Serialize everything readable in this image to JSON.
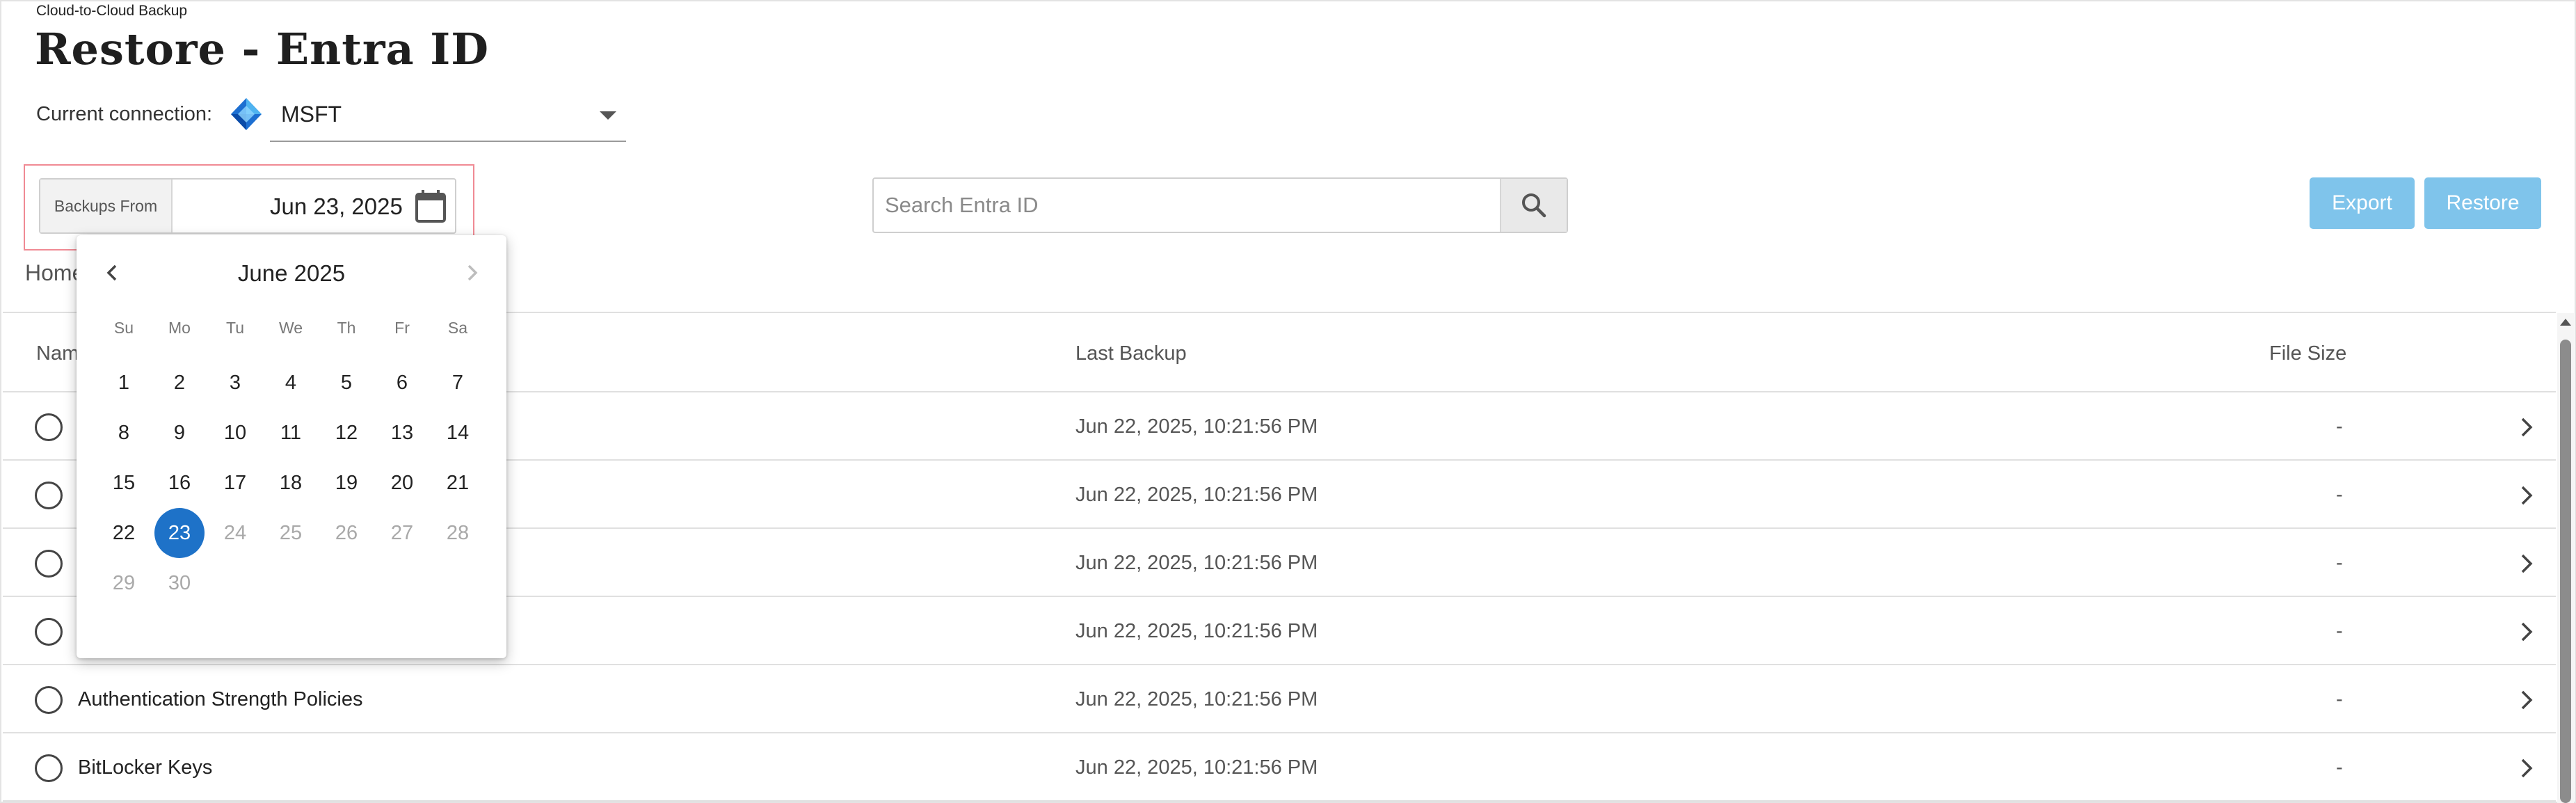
{
  "app": {
    "title": "Cloud-to-Cloud Backup",
    "page_title": "Restore - Entra ID"
  },
  "connection": {
    "label": "Current connection:",
    "value": "MSFT",
    "icon": "azure-logo-icon"
  },
  "date_filter": {
    "label": "Backups From",
    "value": "Jun 23, 2025",
    "icon": "calendar-icon"
  },
  "search": {
    "placeholder": "Search Entra ID",
    "value": "",
    "icon": "search-icon"
  },
  "actions": {
    "export_label": "Export",
    "restore_label": "Restore"
  },
  "breadcrumb": {
    "root": "Home"
  },
  "table": {
    "columns": {
      "name": "Name",
      "last_backup": "Last Backup",
      "file_size": "File Size"
    },
    "rows": [
      {
        "name": "",
        "last_backup": "Jun 22, 2025, 10:21:56 PM",
        "file_size": "-"
      },
      {
        "name": "",
        "last_backup": "Jun 22, 2025, 10:21:56 PM",
        "file_size": "-"
      },
      {
        "name": "",
        "last_backup": "Jun 22, 2025, 10:21:56 PM",
        "file_size": "-"
      },
      {
        "name": "",
        "last_backup": "Jun 22, 2025, 10:21:56 PM",
        "file_size": "-"
      },
      {
        "name": "Authentication Strength Policies",
        "last_backup": "Jun 22, 2025, 10:21:56 PM",
        "file_size": "-"
      },
      {
        "name": "BitLocker Keys",
        "last_backup": "Jun 22, 2025, 10:21:56 PM",
        "file_size": "-"
      }
    ]
  },
  "datepicker": {
    "month_label": "June 2025",
    "weekdays": [
      "Su",
      "Mo",
      "Tu",
      "We",
      "Th",
      "Fr",
      "Sa"
    ],
    "first_weekday_index": 0,
    "days_in_month": 30,
    "selected_day": 23,
    "max_enabled_day": 23
  },
  "colors": {
    "accent": "#1e72c8",
    "button": "#7fc4eb",
    "highlight": "#f08a94"
  }
}
